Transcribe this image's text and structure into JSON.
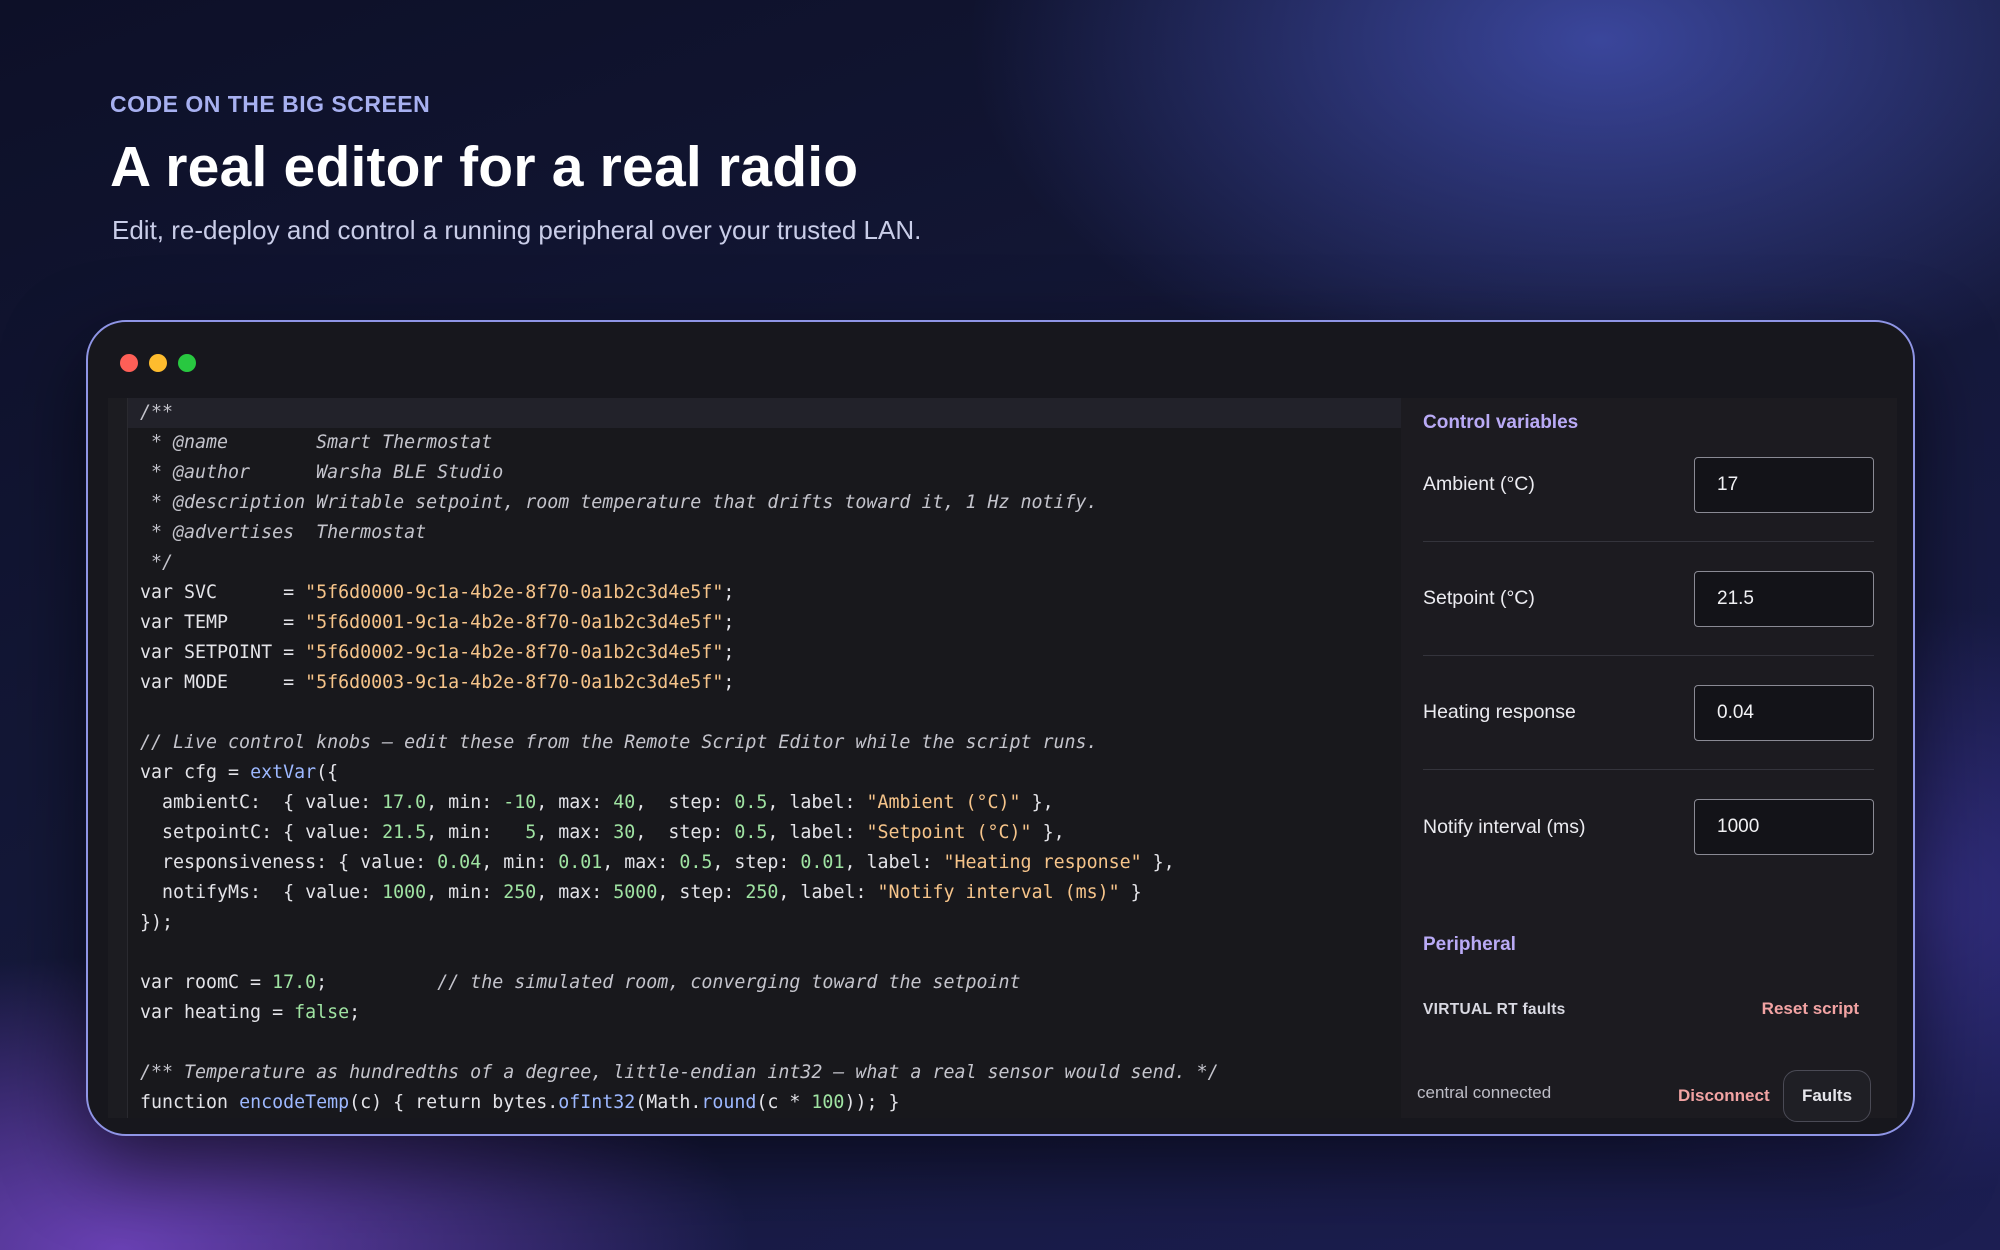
{
  "hero": {
    "eyebrow": "CODE ON THE BIG SCREEN",
    "title": "A real editor for a real radio",
    "subtitle": "Edit, re-deploy and control a running peripheral over your trusted LAN."
  },
  "editor": {
    "lines": [
      {
        "cls": "c active",
        "segs": [
          [
            "",
            "/**"
          ]
        ]
      },
      {
        "cls": "c",
        "segs": [
          [
            "",
            " * @name        Smart Thermostat"
          ]
        ]
      },
      {
        "cls": "c",
        "segs": [
          [
            "",
            " * @author      Warsha BLE Studio"
          ]
        ]
      },
      {
        "cls": "c",
        "segs": [
          [
            "",
            " * @description Writable setpoint, room temperature that drifts toward it, 1 Hz notify."
          ]
        ]
      },
      {
        "cls": "c",
        "segs": [
          [
            "",
            " * @advertises  Thermostat"
          ]
        ]
      },
      {
        "cls": "c",
        "segs": [
          [
            "",
            " */"
          ]
        ]
      },
      {
        "cls": "",
        "segs": [
          [
            "",
            "var SVC      = "
          ],
          [
            "s",
            "\"5f6d0000-9c1a-4b2e-8f70-0a1b2c3d4e5f\""
          ],
          [
            "",
            ";"
          ]
        ]
      },
      {
        "cls": "",
        "segs": [
          [
            "",
            "var TEMP     = "
          ],
          [
            "s",
            "\"5f6d0001-9c1a-4b2e-8f70-0a1b2c3d4e5f\""
          ],
          [
            "",
            ";"
          ]
        ]
      },
      {
        "cls": "",
        "segs": [
          [
            "",
            "var SETPOINT = "
          ],
          [
            "s",
            "\"5f6d0002-9c1a-4b2e-8f70-0a1b2c3d4e5f\""
          ],
          [
            "",
            ";"
          ]
        ]
      },
      {
        "cls": "",
        "segs": [
          [
            "",
            "var MODE     = "
          ],
          [
            "s",
            "\"5f6d0003-9c1a-4b2e-8f70-0a1b2c3d4e5f\""
          ],
          [
            "",
            ";"
          ]
        ]
      },
      {
        "cls": "",
        "segs": [
          [
            "",
            ""
          ]
        ]
      },
      {
        "cls": "c",
        "segs": [
          [
            "",
            "// Live control knobs — edit these from the Remote Script Editor while the script runs."
          ]
        ]
      },
      {
        "cls": "",
        "segs": [
          [
            "",
            "var cfg = "
          ],
          [
            "f",
            "extVar"
          ],
          [
            "",
            "({"
          ]
        ]
      },
      {
        "cls": "",
        "segs": [
          [
            "",
            "  ambientC:  { value: "
          ],
          [
            "n",
            "17.0"
          ],
          [
            "",
            ", min: "
          ],
          [
            "n",
            "-10"
          ],
          [
            "",
            ", max: "
          ],
          [
            "n",
            "40"
          ],
          [
            "",
            ",  step: "
          ],
          [
            "n",
            "0.5"
          ],
          [
            "",
            ", label: "
          ],
          [
            "s",
            "\"Ambient (°C)\""
          ],
          [
            "",
            " },"
          ]
        ]
      },
      {
        "cls": "",
        "segs": [
          [
            "",
            "  setpointC: { value: "
          ],
          [
            "n",
            "21.5"
          ],
          [
            "",
            ", min:   "
          ],
          [
            "n",
            "5"
          ],
          [
            "",
            ", max: "
          ],
          [
            "n",
            "30"
          ],
          [
            "",
            ",  step: "
          ],
          [
            "n",
            "0.5"
          ],
          [
            "",
            ", label: "
          ],
          [
            "s",
            "\"Setpoint (°C)\""
          ],
          [
            "",
            " },"
          ]
        ]
      },
      {
        "cls": "",
        "segs": [
          [
            "",
            "  responsiveness: { value: "
          ],
          [
            "n",
            "0.04"
          ],
          [
            "",
            ", min: "
          ],
          [
            "n",
            "0.01"
          ],
          [
            "",
            ", max: "
          ],
          [
            "n",
            "0.5"
          ],
          [
            "",
            ", step: "
          ],
          [
            "n",
            "0.01"
          ],
          [
            "",
            ", label: "
          ],
          [
            "s",
            "\"Heating response\""
          ],
          [
            "",
            " },"
          ]
        ]
      },
      {
        "cls": "",
        "segs": [
          [
            "",
            "  notifyMs:  { value: "
          ],
          [
            "n",
            "1000"
          ],
          [
            "",
            ", min: "
          ],
          [
            "n",
            "250"
          ],
          [
            "",
            ", max: "
          ],
          [
            "n",
            "5000"
          ],
          [
            "",
            ", step: "
          ],
          [
            "n",
            "250"
          ],
          [
            "",
            ", label: "
          ],
          [
            "s",
            "\"Notify interval (ms)\""
          ],
          [
            "",
            " }"
          ]
        ]
      },
      {
        "cls": "",
        "segs": [
          [
            "",
            "});"
          ]
        ]
      },
      {
        "cls": "",
        "segs": [
          [
            "",
            ""
          ]
        ]
      },
      {
        "cls": "",
        "segs": [
          [
            "",
            "var roomC = "
          ],
          [
            "n",
            "17.0"
          ],
          [
            "",
            ";          "
          ],
          [
            "c",
            "// the simulated room, converging toward the setpoint"
          ]
        ]
      },
      {
        "cls": "",
        "segs": [
          [
            "",
            "var heating = "
          ],
          [
            "n",
            "false"
          ],
          [
            "",
            ";"
          ]
        ]
      },
      {
        "cls": "",
        "segs": [
          [
            "",
            ""
          ]
        ]
      },
      {
        "cls": "c",
        "segs": [
          [
            "",
            "/** Temperature as hundredths of a degree, little-endian int32 — what a real sensor would send. */"
          ]
        ]
      },
      {
        "cls": "",
        "segs": [
          [
            "",
            "function "
          ],
          [
            "f",
            "encodeTemp"
          ],
          [
            "",
            "(c) { return bytes."
          ],
          [
            "f",
            "ofInt32"
          ],
          [
            "",
            "(Math."
          ],
          [
            "f",
            "round"
          ],
          [
            "",
            "(c * "
          ],
          [
            "n",
            "100"
          ],
          [
            "",
            ")); }"
          ]
        ]
      }
    ]
  },
  "panel": {
    "control_title": "Control variables",
    "vars": [
      {
        "label": "Ambient (°C)",
        "value": "17"
      },
      {
        "label": "Setpoint (°C)",
        "value": "21.5"
      },
      {
        "label": "Heating response",
        "value": "0.04"
      },
      {
        "label": "Notify interval (ms)",
        "value": "1000"
      }
    ],
    "peripheral_title": "Peripheral",
    "peripheral_name": "VIRTUAL RT faults",
    "reset_label": "Reset script",
    "status": "central connected",
    "disconnect_label": "Disconnect",
    "faults_label": "Faults"
  },
  "colors": {
    "accent": "#b9aaf5",
    "danger": "#f2a3a3",
    "string": "#f6c48a",
    "number": "#9fe3a2",
    "function": "#9db8ff"
  }
}
